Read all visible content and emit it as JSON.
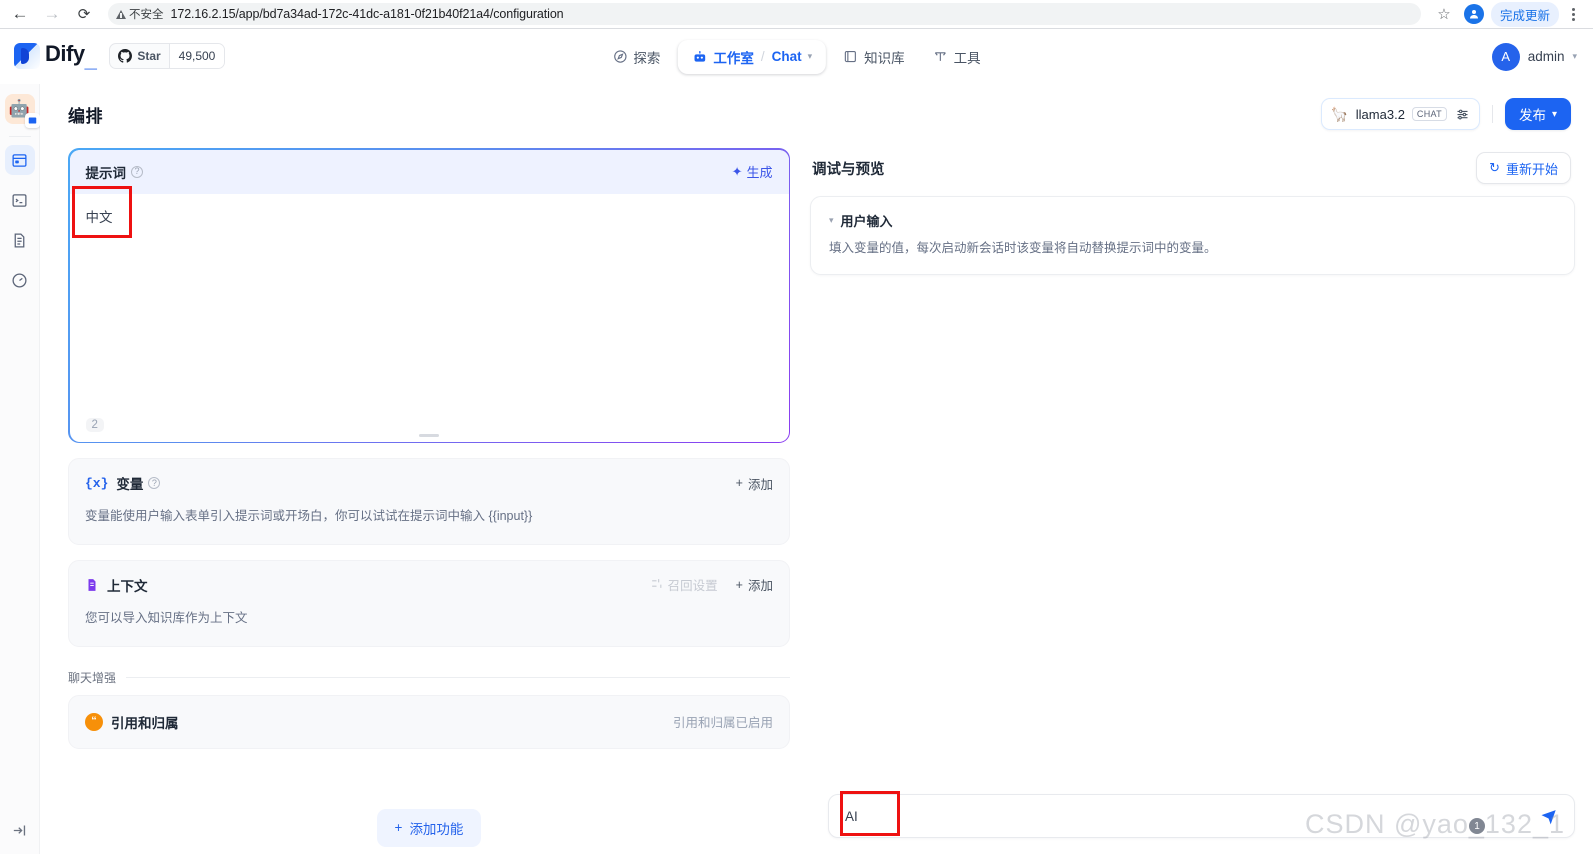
{
  "browser": {
    "back_icon": "back-arrow-icon",
    "forward_icon": "forward-arrow-icon",
    "reload_icon": "reload-icon",
    "security_label": "不安全",
    "url": "172.16.2.15/app/bd7a34ad-172c-41dc-a181-0f21b40f21a4/configuration",
    "bookmark_icon": "star-icon",
    "profile_icon": "profile-avatar-icon",
    "update_button": "完成更新",
    "menu_icon": "kebab-menu-icon"
  },
  "header": {
    "brand": "Dify",
    "brand_suffix": "_",
    "github": {
      "label": "Star",
      "count": "49,500",
      "icon": "github-icon"
    },
    "nav": [
      {
        "id": "explore",
        "label": "探索",
        "icon": "compass-icon",
        "active": false
      },
      {
        "id": "studio",
        "label": "工作室",
        "icon": "robot-icon",
        "active": true
      },
      {
        "id": "separator",
        "label": "/"
      },
      {
        "id": "chat",
        "label": "Chat",
        "icon": "chevron-down-icon",
        "active": true
      },
      {
        "id": "knowledge",
        "label": "知识库",
        "icon": "book-icon",
        "active": false
      },
      {
        "id": "tools",
        "label": "工具",
        "icon": "tool-icon",
        "active": false
      }
    ],
    "user": {
      "initial": "A",
      "name": "admin"
    }
  },
  "rail": {
    "app_icon": "app-robot-avatar",
    "app_badge_icon": "app-type-badge-icon",
    "items": [
      {
        "id": "orchestrate",
        "icon": "orchestrate-window-icon",
        "active": true
      },
      {
        "id": "api-access",
        "icon": "terminal-icon",
        "active": false
      },
      {
        "id": "logs",
        "icon": "logs-document-icon",
        "active": false
      },
      {
        "id": "monitoring",
        "icon": "gauge-icon",
        "active": false
      }
    ],
    "collapse_icon": "collapse-panel-icon"
  },
  "workspace": {
    "page_title": "编排",
    "model_selector": {
      "icon": "llama-icon",
      "name": "llama3.2",
      "badge": "CHAT",
      "settings_icon": "sliders-icon"
    },
    "publish_button": {
      "label": "发布",
      "caret_icon": "chevron-down-icon"
    }
  },
  "prompt_panel": {
    "title": "提示词",
    "info_icon": "info-icon",
    "generate_button": {
      "label": "生成",
      "icon": "sparkle-icon"
    },
    "content": "中文",
    "char_count": "2",
    "resize_handle": "resize-grip"
  },
  "variables_panel": {
    "icon": "variable-braces-icon",
    "title": "变量",
    "info_icon": "info-icon",
    "add_button": "添加",
    "description": "变量能使用户输入表单引入提示词或开场白，你可以试试在提示词中输入 {{input}}"
  },
  "context_panel": {
    "icon": "context-document-icon",
    "title": "上下文",
    "retrieval_button": {
      "label": "召回设置",
      "icon": "retrieval-icon",
      "disabled": true
    },
    "add_button": "添加",
    "description": "您可以导入知识库作为上下文"
  },
  "chat_enhance": {
    "section_label": "聊天增强",
    "feature": {
      "icon": "citation-quote-icon",
      "title": "引用和归属",
      "status": "引用和归属已启用"
    },
    "add_feature_button": {
      "label": "添加功能",
      "icon": "plus-icon"
    }
  },
  "preview_panel": {
    "title": "调试与预览",
    "restart_button": {
      "label": "重新开始",
      "icon": "refresh-icon"
    },
    "user_input": {
      "chevron_icon": "chevron-down-icon",
      "title": "用户输入",
      "description": "填入变量的值，每次启动新会话时该变量将自动替换提示词中的变量。"
    },
    "chat_input": {
      "value": "AI",
      "send_icon": "send-arrow-icon"
    }
  },
  "watermark": {
    "text": "CSDN @yao_132_1"
  }
}
